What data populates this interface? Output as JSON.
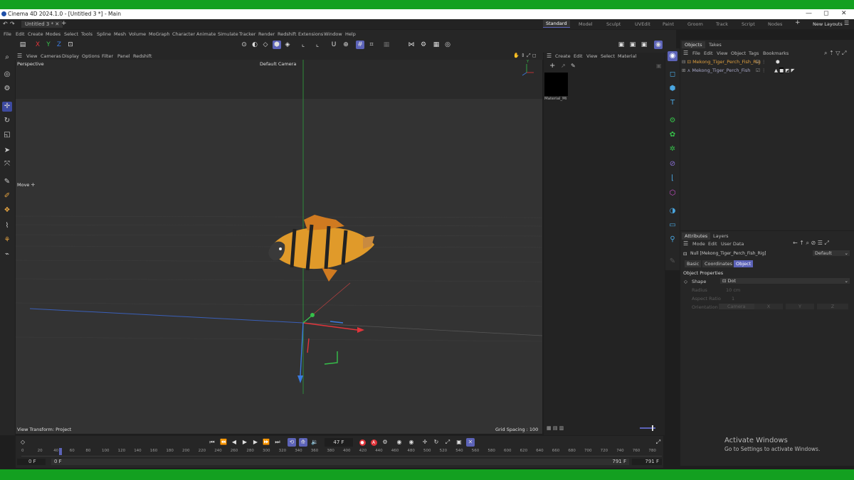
{
  "window": {
    "title": "Cinema 4D 2024.1.0 - [Untitled 3 *] - Main",
    "doc_tab": "Untitled 3 *",
    "controls": [
      "—",
      "◻",
      "✕"
    ]
  },
  "layouts": {
    "items": [
      "Standard",
      "Model",
      "Sculpt",
      "UVEdit",
      "Paint",
      "Groom",
      "Track",
      "Script",
      "Nodes"
    ],
    "active": "Standard",
    "new_layouts": "New Layouts"
  },
  "menu": {
    "items": [
      "File",
      "Edit",
      "Create",
      "Modes",
      "Select",
      "Tools",
      "Spline",
      "Mesh",
      "Volume",
      "MoGraph",
      "Character",
      "Animate",
      "Simulate",
      "Tracker",
      "Render",
      "Redshift",
      "Extensions",
      "Window",
      "Help"
    ]
  },
  "viewport": {
    "menu": [
      "View",
      "Cameras",
      "Display",
      "Options",
      "Filter",
      "Panel",
      "Redshift"
    ],
    "view_name": "Perspective",
    "camera": "Default Camera",
    "tool_hint": "Move ✛",
    "view_transform": "View Transform: Project",
    "grid_spacing": "Grid Spacing : 100 cm",
    "axis_labels": {
      "y": "Y",
      "x": "X",
      "z": "Z"
    }
  },
  "material_panel": {
    "menu": [
      "Create",
      "Edit",
      "View",
      "Select",
      "Material"
    ],
    "material_name": "Material_Mi"
  },
  "objects_panel": {
    "tabs": [
      "Objects",
      "Takes"
    ],
    "menu": [
      "File",
      "Edit",
      "View",
      "Object",
      "Tags",
      "Bookmarks"
    ],
    "items": [
      {
        "name": "Mekong_Tiger_Perch_Fish_Rig",
        "color": "#e0a040"
      },
      {
        "name": "Mekong_Tiger_Perch_Fish",
        "color": "#a8a8c8"
      }
    ]
  },
  "attributes_panel": {
    "tabs": [
      "Attributes",
      "Layers"
    ],
    "menu": [
      "Mode",
      "Edit",
      "User Data"
    ],
    "object_title": "Null [Mekong_Tiger_Perch_Fish_Rig]",
    "preset": "Default",
    "subtabs": [
      "Basic",
      "Coordinates",
      "Object"
    ],
    "active_subtab": "Object",
    "section": "Object Properties",
    "fields": {
      "shape_label": "Shape",
      "shape_value": "Dot",
      "radius_label": "Radius",
      "radius_value": "10 cm",
      "aspect_label": "Aspect Ratio",
      "aspect_value": "1",
      "orientation_label": "Orientation",
      "orientation_value": "Camera",
      "axes": [
        "X",
        "Y",
        "Z"
      ]
    }
  },
  "timeline": {
    "current_frame": "47 F",
    "ticks": [
      "0",
      "20",
      "40",
      "60",
      "80",
      "100",
      "120",
      "140",
      "160",
      "180",
      "200",
      "220",
      "240",
      "260",
      "280",
      "300",
      "320",
      "340",
      "360",
      "380",
      "400",
      "420",
      "440",
      "460",
      "480",
      "500",
      "520",
      "540",
      "560",
      "580",
      "600",
      "620",
      "640",
      "660",
      "680",
      "700",
      "720",
      "740",
      "760",
      "780"
    ],
    "start": "0 F",
    "min": "0 F",
    "max": "791 F",
    "end": "791 F"
  },
  "watermark": {
    "line1": "Activate Windows",
    "line2": "Go to Settings to activate Windows."
  },
  "colors": {
    "accent": "#5c63b8",
    "frame_green": "#13a020",
    "x_axis": "#e0343a",
    "y_axis": "#36c04a",
    "z_axis": "#3a7ae0"
  }
}
